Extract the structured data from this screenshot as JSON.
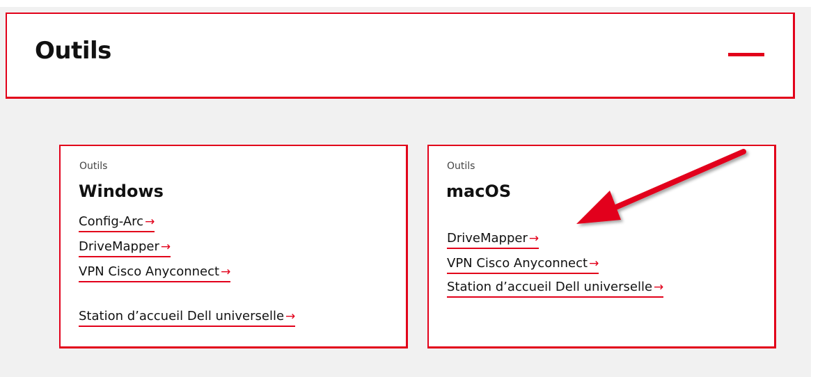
{
  "section": {
    "title": "Outils"
  },
  "cards": [
    {
      "eyebrow": "Outils",
      "title": "Windows",
      "links": [
        {
          "label": "Config-Arc"
        },
        {
          "label": "DriveMapper"
        },
        {
          "label": "VPN Cisco Anyconnect"
        },
        {
          "label": "Station d’accueil Dell universelle"
        }
      ]
    },
    {
      "eyebrow": "Outils",
      "title": "macOS",
      "links": [
        {
          "label": "DriveMapper"
        },
        {
          "label": "VPN Cisco Anyconnect"
        },
        {
          "label": "Station d’accueil Dell universelle"
        }
      ]
    }
  ],
  "icons": {
    "collapse": "minus-icon",
    "link_arrow": "arrow-right-icon",
    "arrow_glyph": "→",
    "annotation": "red-arrow-annotation"
  },
  "colors": {
    "accent": "#e2001a",
    "page_background": "#f1f1f1",
    "text": "#111111"
  }
}
